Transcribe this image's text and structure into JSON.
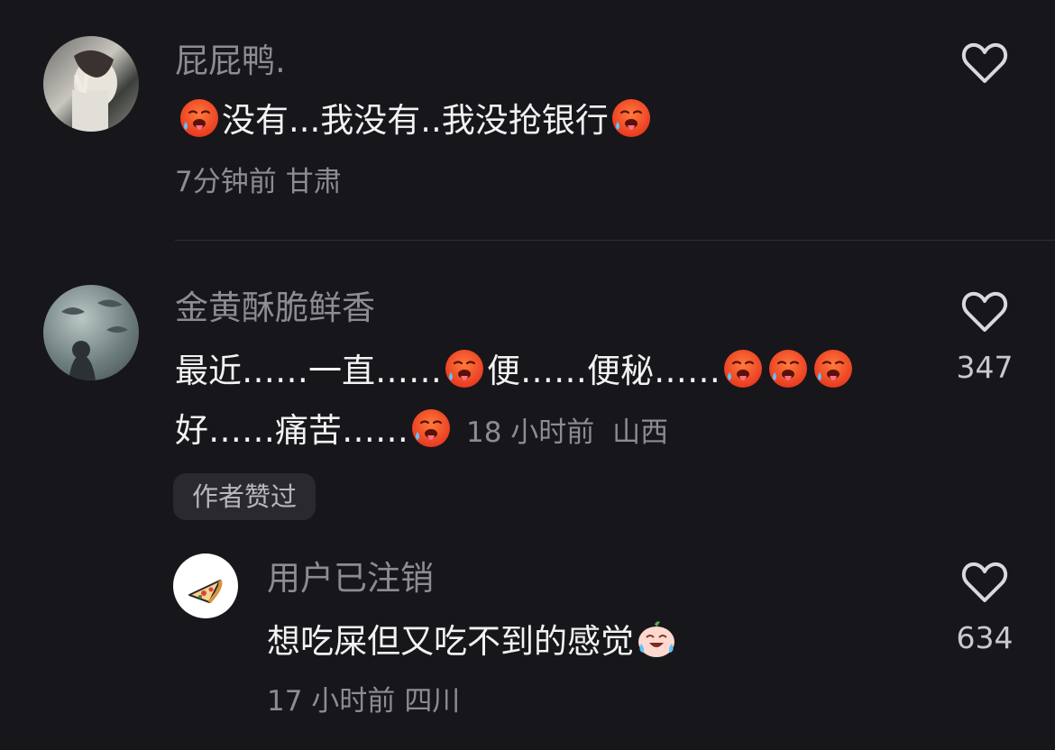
{
  "comments": [
    {
      "username": "屁屁鸭.",
      "text_parts": [
        "没有...我没有..我没抢银行"
      ],
      "emoji": "hot-face",
      "time": "7分钟前",
      "location": "甘肃",
      "likes": ""
    },
    {
      "username": "金黄酥脆鲜香",
      "line1_a": "最近……一直……",
      "line1_b": "便……便秘……",
      "line2_a": "好……痛苦……",
      "emoji": "hot-face",
      "time": "18 小时前",
      "location": "山西",
      "likes": "347",
      "badge": "作者赞过"
    },
    {
      "username": "用户已注销",
      "text": "想吃屎但又吃不到的感觉",
      "emoji": "laughing-crying-face",
      "time": "17 小时前",
      "location": "四川",
      "likes": "634"
    }
  ],
  "colors": {
    "background": "#17161b",
    "username": "#8d8c92",
    "text": "#f2f2f4",
    "meta": "#8d8c92",
    "badge_bg": "#2a292f"
  },
  "icons": {
    "like": "heart-outline-icon",
    "hot_face": "hot-face-emoji",
    "laugh_cry": "laughing-crying-emoji"
  }
}
